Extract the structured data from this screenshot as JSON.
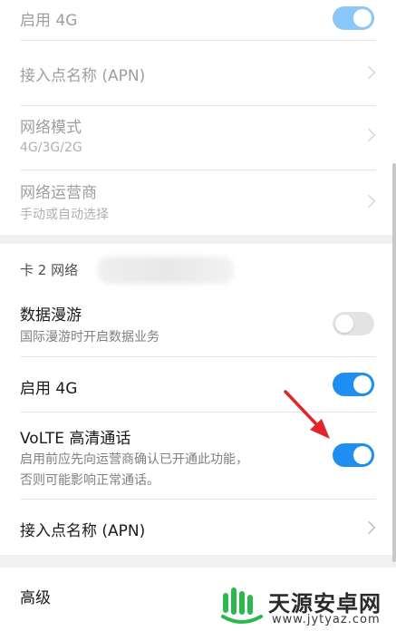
{
  "sim1": {
    "enable_4g": {
      "label": "启用 4G",
      "state": true
    },
    "apn": {
      "label": "接入点名称 (APN)"
    },
    "network_mode": {
      "label": "网络模式",
      "value": "4G/3G/2G"
    },
    "carrier": {
      "label": "网络运营商",
      "value": "手动或自动选择"
    }
  },
  "sim2": {
    "section_label": "卡 2 网络",
    "roaming": {
      "label": "数据漫游",
      "desc": "国际漫游时开启数据业务",
      "state": false
    },
    "enable_4g": {
      "label": "启用 4G",
      "state": true
    },
    "volte": {
      "label": "VoLTE 高清通话",
      "desc_line1": "启用前应先向运营商确认已开通此功能，",
      "desc_line2": "否则可能影响正常通话。",
      "state": true
    },
    "apn": {
      "label": "接入点名称 (APN)"
    }
  },
  "advanced": {
    "label": "高级"
  },
  "watermark": {
    "name": "天源安卓网",
    "url": "www.jytyaz.com"
  },
  "colors": {
    "toggle_on": "#1e8ff0",
    "toggle_on_faded": "#8cc8f7",
    "toggle_off": "#e3e3e3",
    "arrow": "#e0262b"
  }
}
